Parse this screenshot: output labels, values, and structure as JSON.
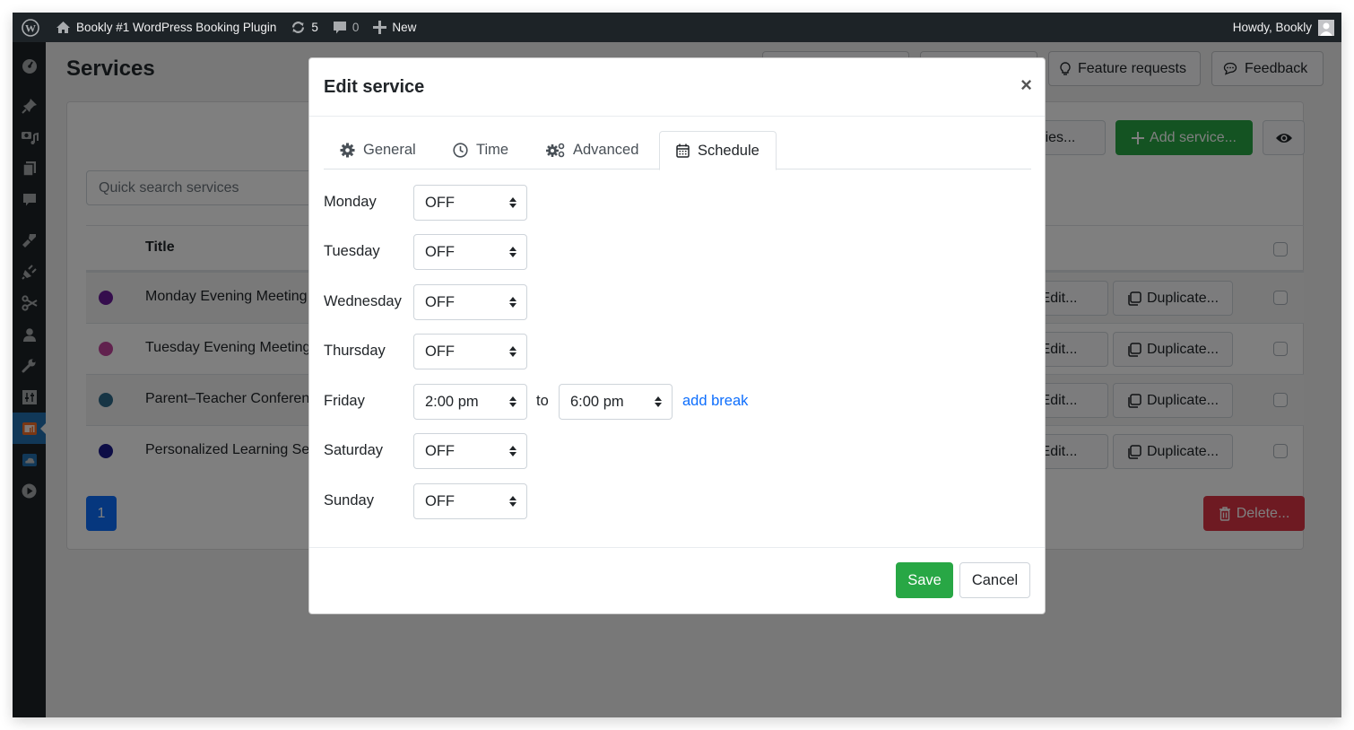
{
  "admin_bar": {
    "site_name": "Bookly #1 WordPress Booking Plugin",
    "updates_count": "5",
    "comments_count": "0",
    "new_label": "New",
    "greeting": "Howdy, Bookly"
  },
  "sidebar": {
    "items": [
      {
        "icon": "dashboard-icon"
      },
      {
        "icon": "pin-icon"
      },
      {
        "icon": "media-icon"
      },
      {
        "icon": "pages-icon"
      },
      {
        "icon": "comments-icon"
      },
      {
        "icon": "appearance-icon"
      },
      {
        "icon": "plugins-icon"
      },
      {
        "icon": "scissors-icon"
      },
      {
        "icon": "users-icon"
      },
      {
        "icon": "tools-icon"
      },
      {
        "icon": "settings-icon"
      },
      {
        "icon": "bookly-icon",
        "active": true
      },
      {
        "icon": "cloud-icon"
      },
      {
        "icon": "play-icon"
      }
    ]
  },
  "page": {
    "title": "Services",
    "feature_requests_label": "Feature requests",
    "feedback_label": "Feedback",
    "search_placeholder": "Quick search services",
    "categories_label": "Categories...",
    "add_service_label": "Add service...",
    "table": {
      "title_header": "Title",
      "rows": [
        {
          "title": "Monday Evening Meeting",
          "color": "#6a1b9a",
          "edit": "Edit...",
          "duplicate": "Duplicate..."
        },
        {
          "title": "Tuesday Evening Meeting",
          "color": "#c2459c",
          "edit": "Edit...",
          "duplicate": "Duplicate..."
        },
        {
          "title": "Parent–Teacher Conference",
          "color": "#2e6b8a",
          "edit": "Edit...",
          "duplicate": "Duplicate..."
        },
        {
          "title": "Personalized Learning Session",
          "color": "#1a1a8c",
          "edit": "Edit...",
          "duplicate": "Duplicate..."
        }
      ]
    },
    "pagination_current": "1",
    "delete_label": "Delete..."
  },
  "modal": {
    "title": "Edit service",
    "close_symbol": "×",
    "tabs": [
      {
        "label": "General",
        "icon": "gear-icon"
      },
      {
        "label": "Time",
        "icon": "clock-icon"
      },
      {
        "label": "Advanced",
        "icon": "gears-icon"
      },
      {
        "label": "Schedule",
        "icon": "calendar-icon",
        "active": true
      }
    ],
    "schedule": [
      {
        "day": "Monday",
        "start": "OFF"
      },
      {
        "day": "Tuesday",
        "start": "OFF"
      },
      {
        "day": "Wednesday",
        "start": "OFF"
      },
      {
        "day": "Thursday",
        "start": "OFF"
      },
      {
        "day": "Friday",
        "start": "2:00 pm",
        "to_label": "to",
        "end": "6:00 pm",
        "add_break": "add break"
      },
      {
        "day": "Saturday",
        "start": "OFF"
      },
      {
        "day": "Sunday",
        "start": "OFF"
      }
    ],
    "save_label": "Save",
    "cancel_label": "Cancel"
  },
  "colors": {
    "primary": "#0d6efd",
    "success": "#28a745",
    "danger": "#dc3545",
    "admin_bar": "#1d2327",
    "sidebar_active": "#2271b1"
  }
}
